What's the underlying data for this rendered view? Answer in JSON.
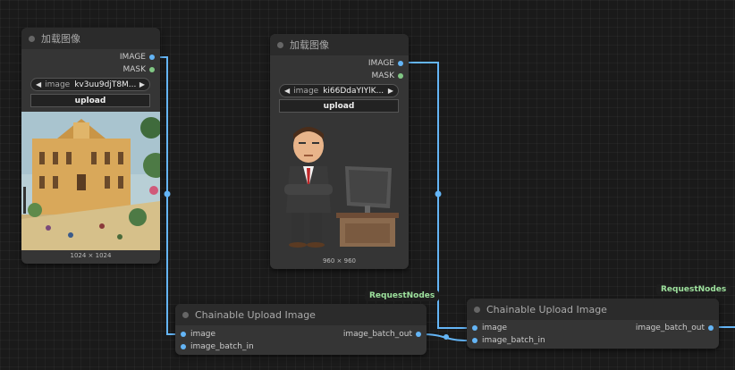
{
  "load_nodes": [
    {
      "title": "加载图像",
      "outputs": [
        "IMAGE",
        "MASK"
      ],
      "image_widget_label": "image",
      "image_widget_value": "kv3uu9djT8M...",
      "upload_label": "upload",
      "size_label": "1024 × 1024"
    },
    {
      "title": "加载图像",
      "outputs": [
        "IMAGE",
        "MASK"
      ],
      "image_widget_label": "image",
      "image_widget_value": "ki66DdaYIYlK...",
      "upload_label": "upload",
      "size_label": "960 × 960"
    }
  ],
  "chain_nodes": [
    {
      "badge": "RequestNodes",
      "title": "Chainable Upload Image",
      "inputs": [
        "image",
        "image_batch_in"
      ],
      "output": "image_batch_out"
    },
    {
      "badge": "RequestNodes",
      "title": "Chainable Upload Image",
      "inputs": [
        "image",
        "image_batch_in"
      ],
      "output": "image_batch_out"
    }
  ],
  "colors": {
    "canvas": "#1a1a1a",
    "node": "#353535",
    "wire_image": "#64b5f6",
    "mask_slot": "#81c784",
    "badge_text": "#9ee29e"
  }
}
